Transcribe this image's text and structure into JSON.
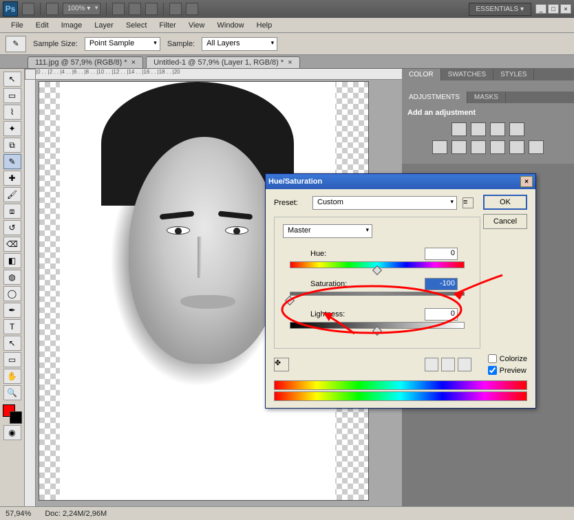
{
  "app": {
    "name": "Ps",
    "workspace": "ESSENTIALS ▾",
    "zoom_combo": "100% ▾"
  },
  "menu": [
    "File",
    "Edit",
    "Image",
    "Layer",
    "Select",
    "Filter",
    "View",
    "Window",
    "Help"
  ],
  "optbar": {
    "sample_size_label": "Sample Size:",
    "sample_size_value": "Point Sample",
    "sample_label": "Sample:",
    "sample_value": "All Layers"
  },
  "tabs": [
    {
      "label": "111.jpg @ 57,9% (RGB/8) *",
      "active": false
    },
    {
      "label": "Untitled-1 @ 57,9% (Layer 1, RGB/8) *",
      "active": true
    }
  ],
  "panels": {
    "color_tabs": [
      "COLOR",
      "SWATCHES",
      "STYLES"
    ],
    "adj_tabs": [
      "ADJUSTMENTS",
      "MASKS"
    ],
    "adj_heading": "Add an adjustment"
  },
  "status": {
    "zoom": "57,94%",
    "doc": "Doc: 2,24M/2,96M"
  },
  "dialog": {
    "title": "Hue/Saturation",
    "preset_label": "Preset:",
    "preset_value": "Custom",
    "channel": "Master",
    "hue_label": "Hue:",
    "hue_value": "0",
    "sat_label": "Saturation:",
    "sat_value": "-100",
    "light_label": "Lightness:",
    "light_value": "0",
    "ok": "OK",
    "cancel": "Cancel",
    "colorize": "Colorize",
    "preview": "Preview"
  },
  "tools": [
    "↖",
    "▭",
    "✂",
    "✥",
    "✎",
    "↗",
    "▱",
    "✐",
    "⧉",
    "⌫",
    "◧",
    "▤",
    "⬤",
    "⬡",
    "✒",
    "T",
    "↖",
    "⊞",
    "✋",
    "🔍"
  ],
  "colors": {
    "fg": "#ff0000",
    "bg": "#000000"
  }
}
